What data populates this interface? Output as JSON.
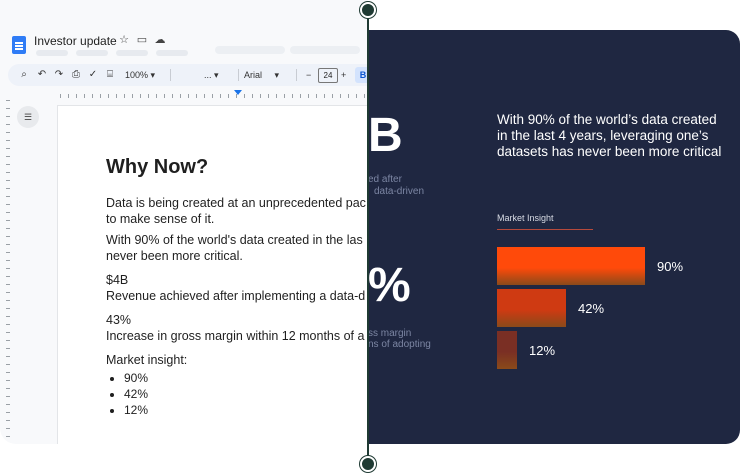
{
  "docs": {
    "title": "Investor update",
    "toolbar": {
      "zoom": "100%",
      "style": "...",
      "font": "Arial",
      "font_size": "24",
      "minus": "−",
      "plus": "+",
      "bold": "B"
    },
    "heading": "Why Now?",
    "paragraphs": [
      "Data is being created at an unprecedented pac",
      "to make sense of it.",
      "With 90% of the world's data created in the las",
      "never been more critical.",
      "$4B",
      "Revenue achieved after implementing a data-d",
      "43%",
      "Increase in gross margin within 12 months of a",
      "Market insight:"
    ],
    "list": [
      "90%",
      "42%",
      "12%"
    ]
  },
  "slide": {
    "partial_big_1": "B",
    "partial_sub_1a": "ed after",
    "partial_sub_1b": "data-driven",
    "partial_big_2": "%",
    "partial_sub_2a": "ss margin",
    "partial_sub_2b": "ns of adopting",
    "headline": "With 90% of the world’s data created in the last 4 years, leveraging one’s datasets has never been more critical",
    "insight_label": "Market Insight"
  },
  "chart_data": {
    "type": "bar",
    "title": "Market Insight",
    "categories": [
      "90%",
      "42%",
      "12%"
    ],
    "values": [
      90,
      42,
      12
    ],
    "colors": [
      "#ff4a0a",
      "#cf3a12",
      "#7a2f24"
    ]
  }
}
